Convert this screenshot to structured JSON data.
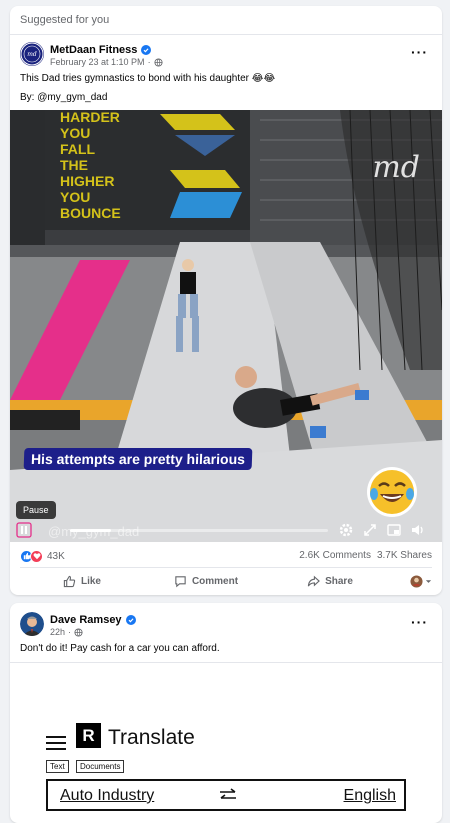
{
  "post1": {
    "suggested_label": "Suggested for you",
    "author": "MetDaan Fitness",
    "avatar_text": "md",
    "date": "February 23 at 1:10 PM",
    "text": "This Dad tries gymnastics to bond with his daughter 😂😂",
    "byline": "By: @my_gym_dad",
    "video": {
      "caption": "His attempts are pretty hilarious",
      "watermark": "md",
      "wall_text": [
        "HARDER",
        "YOU",
        "FALL",
        "THE",
        "HIGHER",
        "YOU",
        "BOUNCE"
      ],
      "tooltip": "Pause",
      "handle": "@my_gym_dad",
      "progress": 0.16
    },
    "reactions_count": "43K",
    "comments": "2.6K Comments",
    "shares": "3.7K Shares",
    "actions": {
      "like": "Like",
      "comment": "Comment",
      "share": "Share"
    }
  },
  "post2": {
    "author": "Dave Ramsey",
    "time": "22h",
    "text": "Don't do it! Pay cash for a car you can afford.",
    "translate": {
      "logo_letter": "R",
      "title": "Translate",
      "tabs": [
        "Text",
        "Documents"
      ],
      "source_lang": "Auto Industry",
      "target_lang": "English"
    }
  },
  "colors": {
    "brand_blue": "#1877f2",
    "caption_bg": "#1d1f8a",
    "love_red": "#f33e58"
  }
}
